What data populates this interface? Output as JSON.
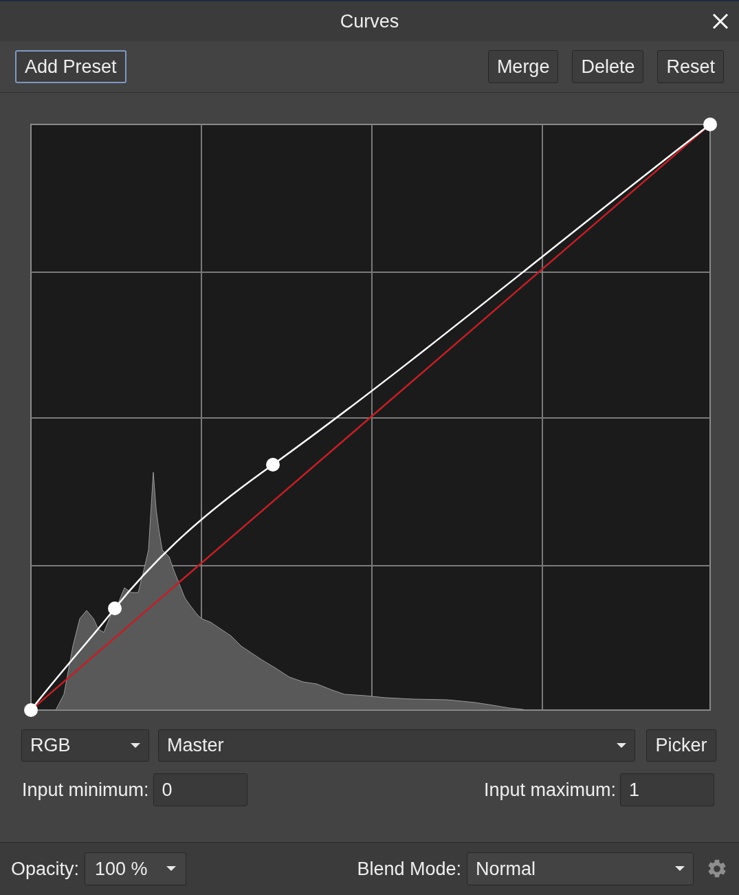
{
  "window": {
    "title": "Curves"
  },
  "toolbar": [
    {
      "label": "Add Preset",
      "focused": true
    },
    {
      "label": "Merge",
      "focused": false
    },
    {
      "label": "Delete",
      "focused": false
    },
    {
      "label": "Reset",
      "focused": false
    }
  ],
  "channel": {
    "value": "RGB"
  },
  "component": {
    "value": "Master"
  },
  "picker": {
    "label": "Picker"
  },
  "input_minimum": {
    "label": "Input minimum:",
    "value": "0"
  },
  "input_maximum": {
    "label": "Input maximum:",
    "value": "1"
  },
  "opacity": {
    "label": "Opacity:",
    "value": "100 %"
  },
  "blend_mode": {
    "label": "Blend Mode:",
    "value": "Normal"
  }
}
